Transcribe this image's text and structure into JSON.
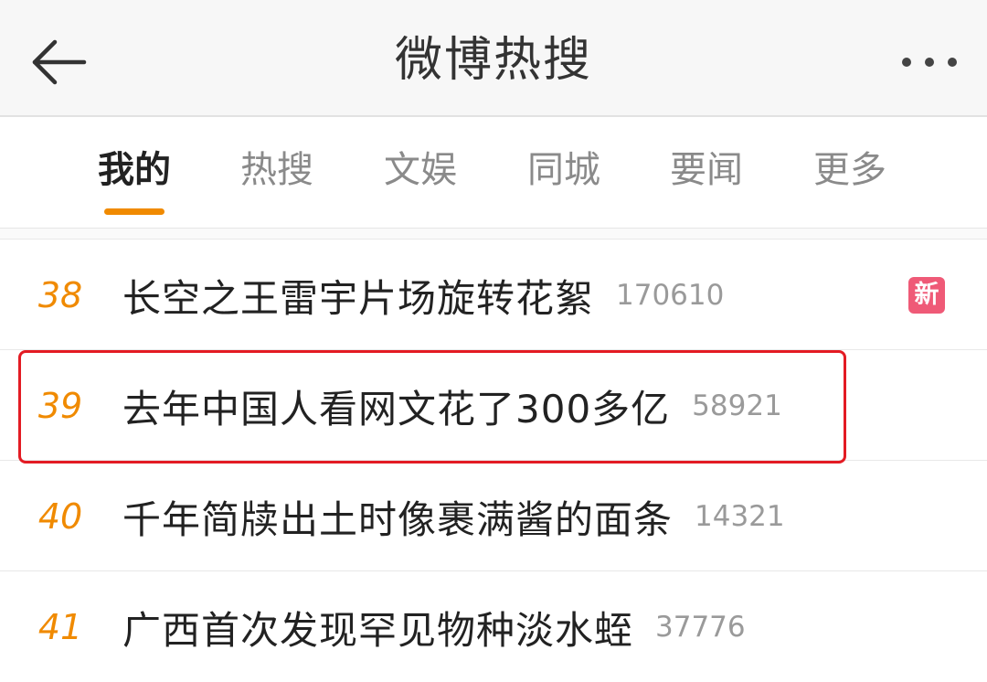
{
  "header": {
    "title": "微博热搜",
    "back_icon": "arrow-left-icon",
    "more_icon": "more-dots-icon"
  },
  "tabs": [
    {
      "label": "我的",
      "active": true
    },
    {
      "label": "热搜",
      "active": false
    },
    {
      "label": "文娱",
      "active": false
    },
    {
      "label": "同城",
      "active": false
    },
    {
      "label": "要闻",
      "active": false
    },
    {
      "label": "更多",
      "active": false
    }
  ],
  "hot_list": [
    {
      "rank": "38",
      "topic": "长空之王雷宇片场旋转花絮",
      "count": "170610",
      "badge": "新"
    },
    {
      "rank": "39",
      "topic": "去年中国人看网文花了300多亿",
      "count": "58921",
      "highlighted": true
    },
    {
      "rank": "40",
      "topic": "千年简牍出土时像裹满酱的面条",
      "count": "14321"
    },
    {
      "rank": "41",
      "topic": "广西首次发现罕见物种淡水蛭",
      "count": "37776"
    }
  ],
  "colors": {
    "accent": "#f08a00",
    "new_badge": "#ef5a77",
    "highlight_border": "#e31b23"
  }
}
